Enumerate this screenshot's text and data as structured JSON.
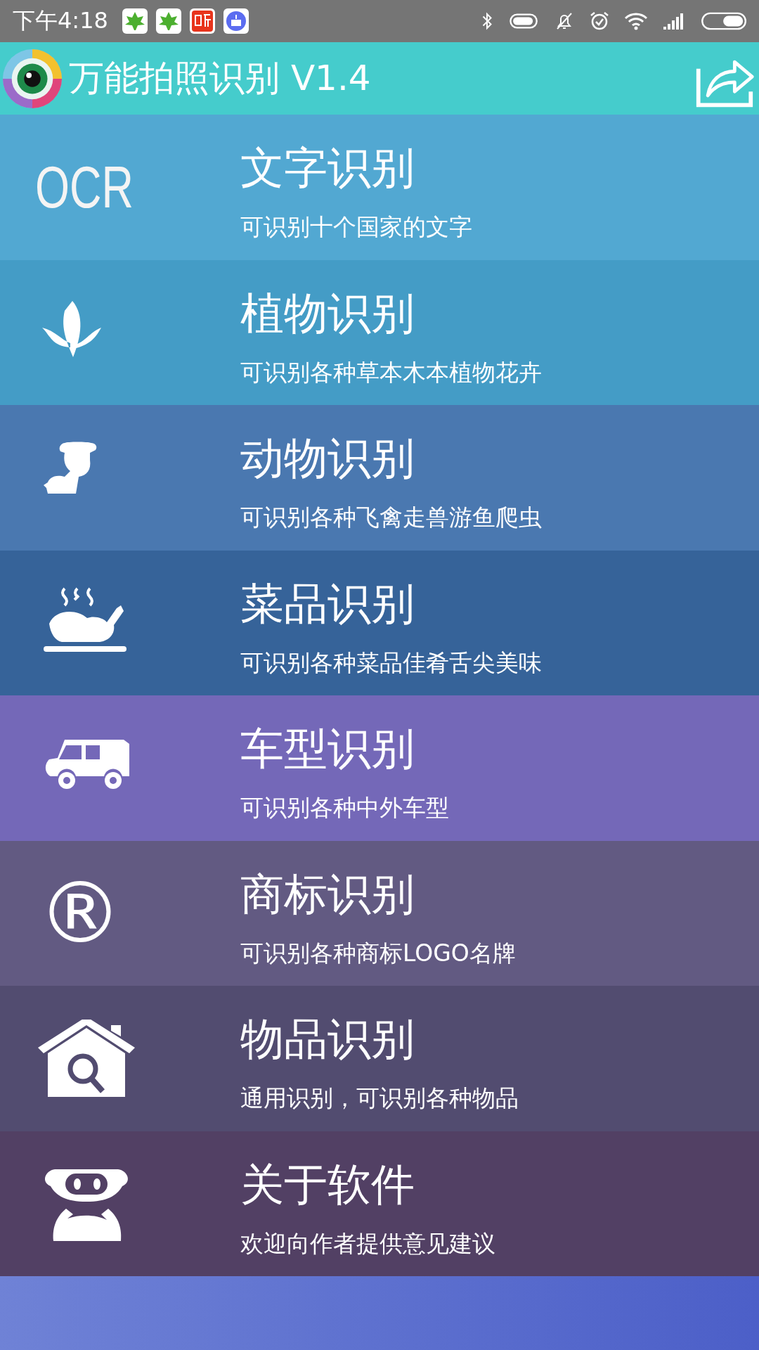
{
  "status_bar": {
    "time": "下午4:18"
  },
  "header": {
    "title": "万能拍照识别 V1.4"
  },
  "items": [
    {
      "icon_text": "OCR",
      "title": "文字识别",
      "subtitle": "可识别十个国家的文字",
      "color": "#52a8d2"
    },
    {
      "title": "植物识别",
      "subtitle": "可识别各种草本木本植物花卉",
      "color": "#449cc6"
    },
    {
      "title": "动物识别",
      "subtitle": "可识别各种飞禽走兽游鱼爬虫",
      "color": "#4a78b0"
    },
    {
      "title": "菜品识别",
      "subtitle": "可识别各种菜品佳肴舌尖美味",
      "color": "#366399"
    },
    {
      "title": "车型识别",
      "subtitle": "可识别各种中外车型",
      "color": "#7468b8"
    },
    {
      "icon_text": "®",
      "title": "商标识别",
      "subtitle": "可识别各种商标LOGO名牌",
      "color": "#625a82"
    },
    {
      "title": "物品识别",
      "subtitle": "通用识别，可识别各种物品",
      "color": "#524c70"
    },
    {
      "title": "关于软件",
      "subtitle": "欢迎向作者提供意见建议",
      "color": "#524064"
    }
  ]
}
